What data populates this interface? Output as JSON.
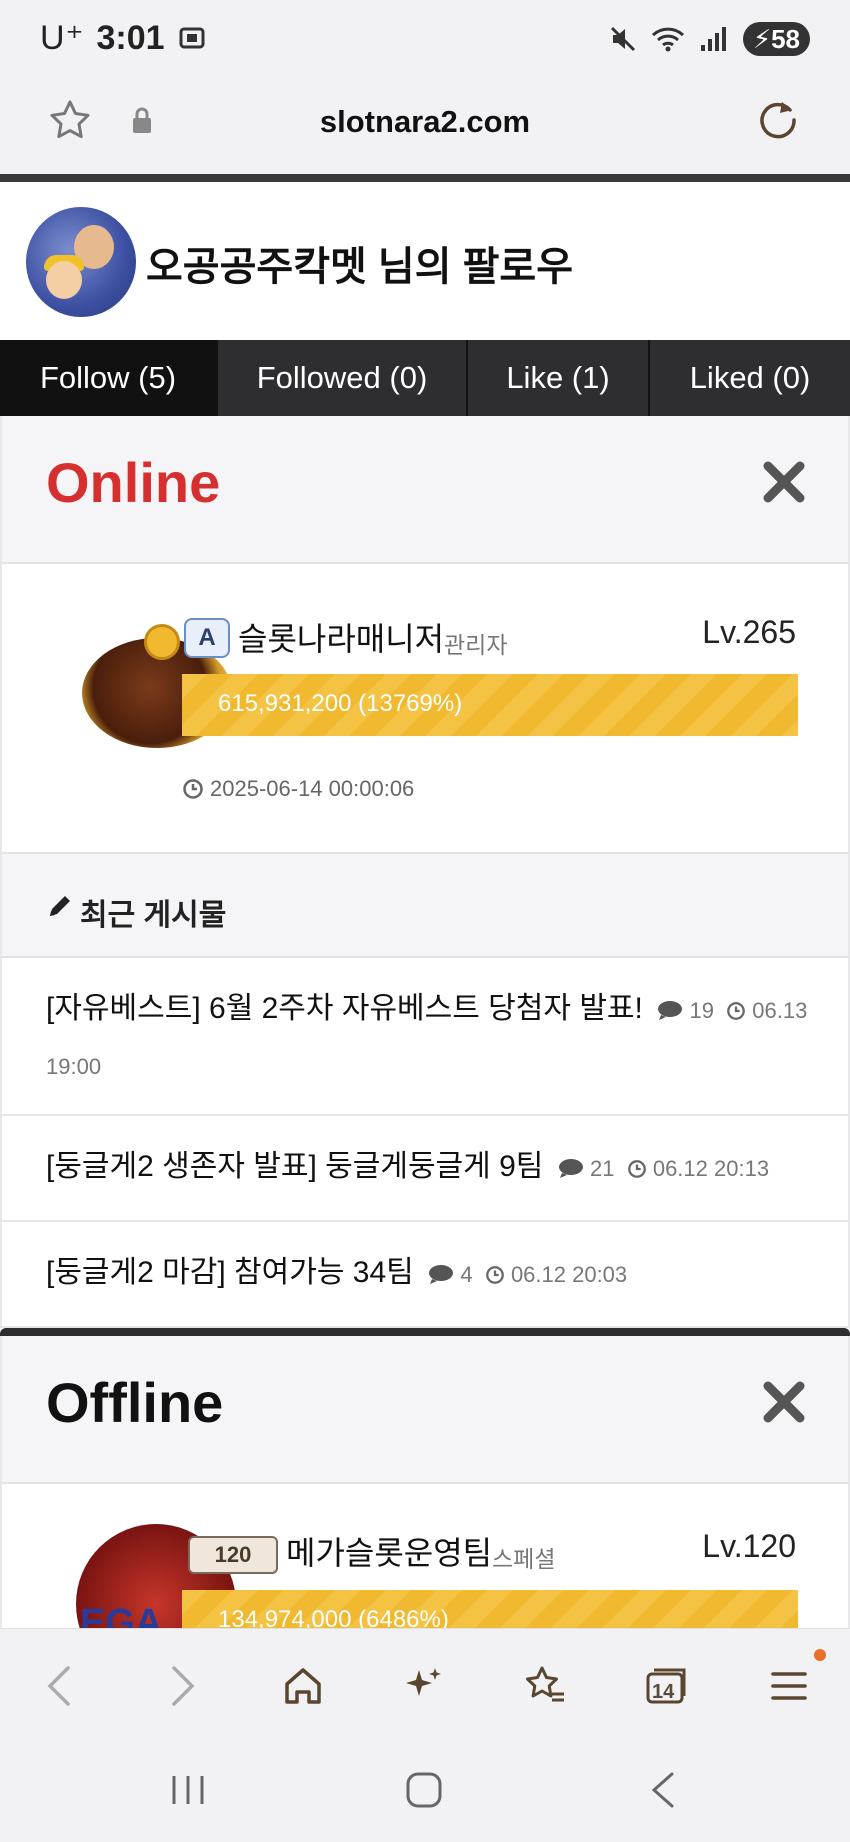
{
  "status_bar": {
    "carrier": "U⁺",
    "time": "3:01",
    "battery": "58"
  },
  "browser": {
    "url": "slotnara2.com",
    "tabs_count": "14"
  },
  "profile": {
    "title": "오공공주칵멧 님의 팔로우"
  },
  "tabs": [
    {
      "label": "Follow (5)",
      "active": true
    },
    {
      "label": "Followed (0)",
      "active": false
    },
    {
      "label": "Like (1)",
      "active": false
    },
    {
      "label": "Liked (0)",
      "active": false
    }
  ],
  "online": {
    "title": "Online",
    "title_color": "#d62f2f",
    "member": {
      "badge": "A",
      "name": "슬롯나라매니저",
      "role": "관리자",
      "level": "Lv.265",
      "xp": "615,931,200 (13769%)",
      "date": "2025-06-14 00:00:06"
    },
    "recent_title": "최근 게시물",
    "posts": [
      {
        "title": "[자유베스트] 6월 2주차 자유베스트 당첨자 발표!",
        "comments": "19",
        "date": "06.13 19:00"
      },
      {
        "title": "[둥글게2 생존자 발표] 둥글게둥글게 9팀",
        "comments": "21",
        "date": "06.12 20:13"
      },
      {
        "title": "[둥글게2 마감] 참여가능 34팀",
        "comments": "4",
        "date": "06.12 20:03"
      }
    ]
  },
  "offline": {
    "title": "Offline",
    "title_color": "#111111",
    "member": {
      "badge": "120",
      "name": "메가슬롯운영팀",
      "role": "스페셜",
      "level": "Lv.120",
      "xp": "134,974,000 (6486%)"
    }
  },
  "colors": {
    "xp_bar": "#f4c343",
    "tab_bg": "#2e2e30",
    "accent_red": "#d62f2f"
  }
}
